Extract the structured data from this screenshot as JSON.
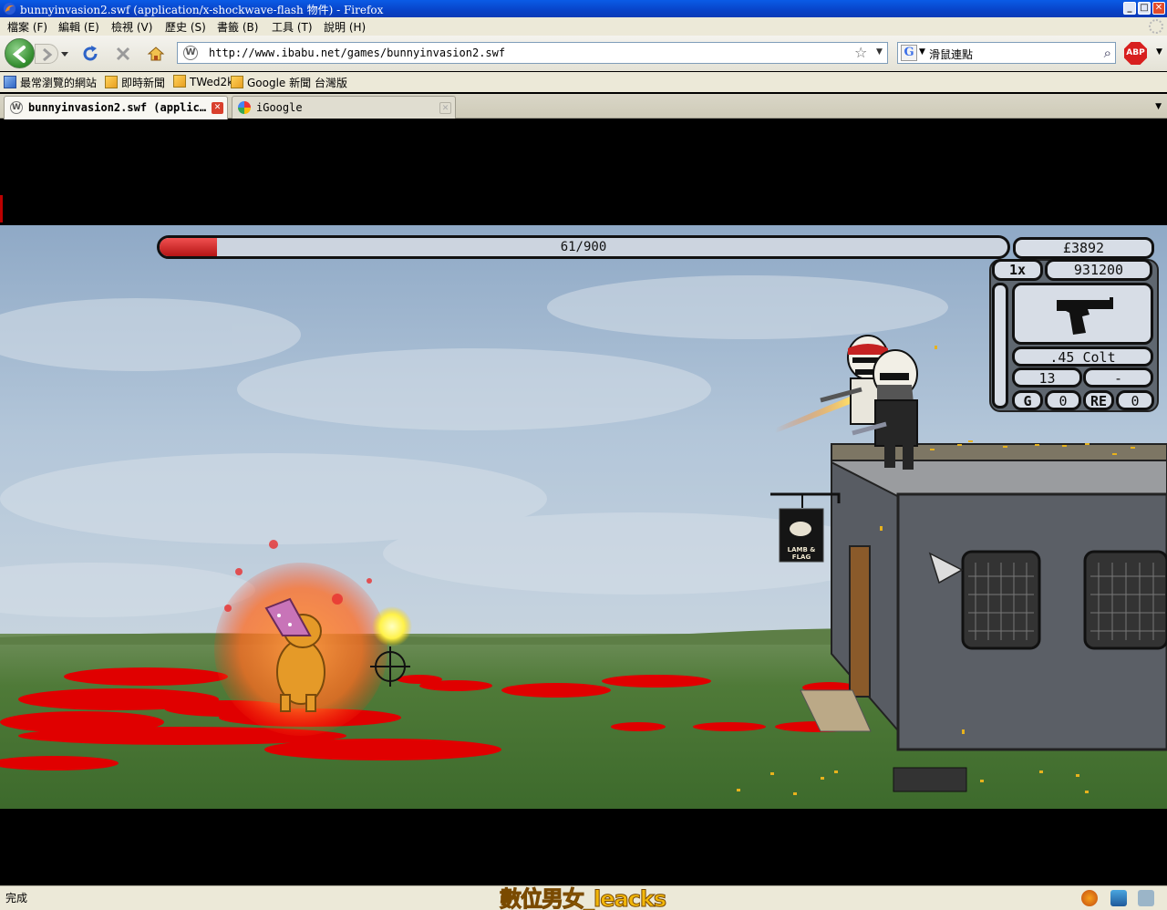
{
  "window": {
    "title": "bunnyinvasion2.swf (application/x-shockwave-flash 物件) - Firefox",
    "minimize_glyph": "_",
    "maximize_glyph": "□",
    "close_glyph": "✕"
  },
  "menu": [
    "檔案 (F)",
    "編輯 (E)",
    "檢視 (V)",
    "歷史 (S)",
    "書籤 (B)",
    "工具 (T)",
    "說明 (H)"
  ],
  "nav": {
    "url": "http://www.ibabu.net/games/bunnyinvasion2.swf",
    "url_favicon": "W",
    "search_engine_glyph": "G",
    "search_text": "滑鼠連點",
    "adblock_label": "ABP",
    "icons": [
      "back-arrow-icon",
      "forward-arrow-icon",
      "reload-icon",
      "stop-icon",
      "home-icon",
      "bookmark-star-icon",
      "search-magnifier-icon"
    ]
  },
  "bookmarks": [
    "最常瀏覽的網站",
    "即時新聞",
    "TWed2k",
    "Google 新聞 台灣版"
  ],
  "tabs": [
    {
      "label": "bunnyinvasion2.swf (applic…",
      "favicon": "W",
      "active": true
    },
    {
      "label": "iGoogle",
      "favicon": "",
      "active": false
    }
  ],
  "tab_close_glyph": "✕",
  "hud": {
    "health_text": "61/900",
    "health_fraction": 0.068,
    "money": "£3892",
    "multiplier": "1x",
    "score": "931200",
    "weapon_name": ".45 Colt",
    "ammo": "13",
    "reserve": "-",
    "grenade_label": "G",
    "grenades": "0",
    "remote_label": "RE",
    "remote": "0"
  },
  "scene": {
    "pub_sign_text_1": "LAMB &",
    "pub_sign_text_2": "FLAG"
  },
  "colors": {
    "sky": "#b5c8dc",
    "grass": "#4f7a38",
    "blood": "#e00000",
    "stone": "#5b5f66"
  },
  "status": {
    "text": "完成",
    "watermark": "數位男女_leacks"
  }
}
